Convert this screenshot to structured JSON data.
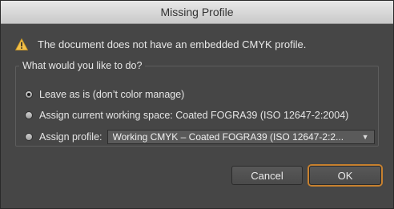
{
  "window": {
    "title": "Missing Profile"
  },
  "message": {
    "text": "The document does not have an embedded CMYK profile.",
    "icon": "warning-icon",
    "icon_color": "#f3c14a"
  },
  "group": {
    "legend": "What would you like to do?"
  },
  "options": [
    {
      "label": "Leave as is (don’t color manage)",
      "selected": true
    },
    {
      "label": "Assign current working space: Coated FOGRA39 (ISO 12647-2:2004)",
      "selected": false
    },
    {
      "label": "Assign profile:",
      "selected": false
    }
  ],
  "profile_select": {
    "value": "Working CMYK – Coated FOGRA39 (ISO 12647-2:2..."
  },
  "buttons": {
    "cancel": "Cancel",
    "ok": "OK"
  },
  "colors": {
    "accent_focus": "#c7812f",
    "dialog_bg": "#464646"
  }
}
